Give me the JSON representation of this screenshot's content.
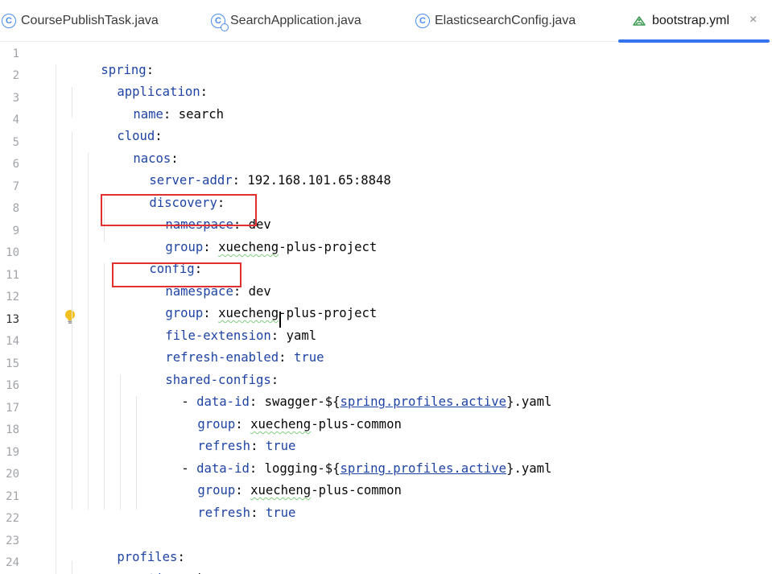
{
  "tabs": [
    {
      "label": "CoursePublishTask.java",
      "icon": "class-icon"
    },
    {
      "label": "SearchApplication.java",
      "icon": "app-icon"
    },
    {
      "label": "ElasticsearchConfig.java",
      "icon": "class-icon"
    },
    {
      "label": "bootstrap.yml",
      "icon": "yaml-icon"
    }
  ],
  "class_icon_glyph": "C",
  "close_glyph": "×",
  "line_numbers": [
    "1",
    "2",
    "3",
    "4",
    "5",
    "6",
    "7",
    "8",
    "9",
    "10",
    "11",
    "12",
    "13",
    "14",
    "15",
    "16",
    "17",
    "18",
    "19",
    "20",
    "21",
    "22",
    "23",
    "24"
  ],
  "current_line": 13,
  "code": {
    "l1": {
      "key": "spring",
      "colon": ":"
    },
    "l2": {
      "key": "application",
      "colon": ":"
    },
    "l3": {
      "key": "name",
      "colon": ": ",
      "value": "search"
    },
    "l4": {
      "key": "cloud",
      "colon": ":"
    },
    "l5": {
      "key": "nacos",
      "colon": ":"
    },
    "l6": {
      "key": "server-addr",
      "colon": ": ",
      "value": "192.168.101.65:8848"
    },
    "l7": {
      "key": "discovery",
      "colon": ":"
    },
    "l8": {
      "key": "namespace",
      "colon": ": ",
      "value": "dev"
    },
    "l9": {
      "key": "group",
      "colon": ": ",
      "value_a": "xuecheng",
      "value_b": "-plus-project"
    },
    "l10": {
      "key": "config",
      "colon": ":"
    },
    "l11": {
      "key": "namespace",
      "colon": ": ",
      "value": "dev"
    },
    "l12": {
      "key": "group",
      "colon": ": ",
      "value_a": "xuecheng",
      "value_b": "-plus-project"
    },
    "l13": {
      "key": "file-extension",
      "colon": ": ",
      "value": "yaml"
    },
    "l14": {
      "key": "refresh-enabled",
      "colon": ": ",
      "value": "true"
    },
    "l15": {
      "key": "shared-configs",
      "colon": ":"
    },
    "l16": {
      "dash": "- ",
      "key": "data-id",
      "colon": ": ",
      "prefix": "swagger-${",
      "ref": "spring.profiles.active",
      "suffix": "}.yaml"
    },
    "l17": {
      "key": "group",
      "colon": ": ",
      "value_a": "xuecheng",
      "value_b": "-plus-common"
    },
    "l18": {
      "key": "refresh",
      "colon": ": ",
      "value": "true"
    },
    "l19": {
      "dash": "- ",
      "key": "data-id",
      "colon": ": ",
      "prefix": "logging-${",
      "ref": "spring.profiles.active",
      "suffix": "}.yaml"
    },
    "l20": {
      "key": "group",
      "colon": ": ",
      "value_a": "xuecheng",
      "value_b": "-plus-common"
    },
    "l21": {
      "key": "refresh",
      "colon": ": ",
      "value": "true"
    },
    "l23": {
      "key": "profiles",
      "colon": ":"
    },
    "l24": {
      "key": "active",
      "colon": ": ",
      "value": "dev"
    }
  },
  "colors": {
    "key": "#1f44a4",
    "active_tab_underline": "#3574f0",
    "highlight_box": "#e0302f",
    "class_icon": "#4a8df0",
    "yaml_icon": "#3e9b55"
  }
}
